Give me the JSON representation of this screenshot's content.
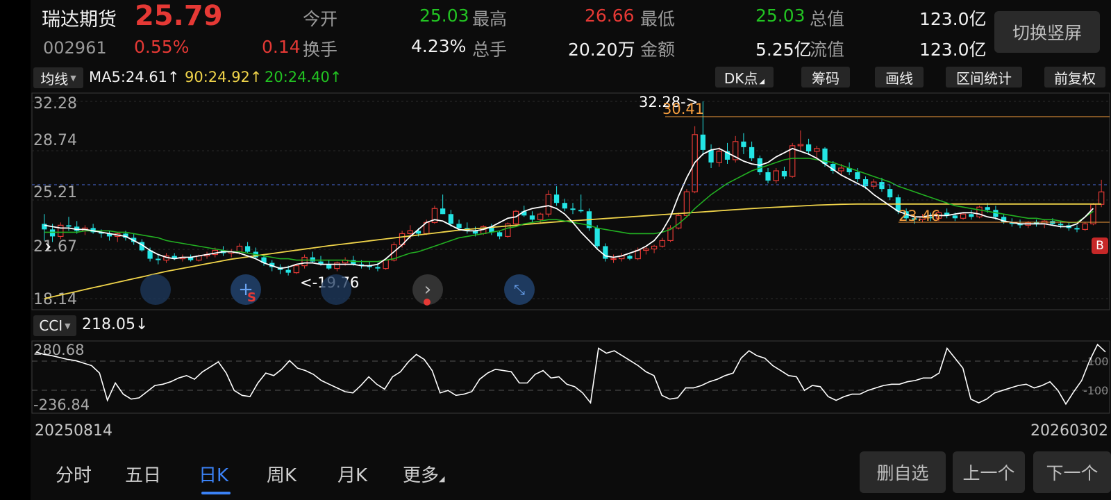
{
  "quote": {
    "name": "瑞达期货",
    "code": "002961",
    "price": "25.79",
    "change_pct": "0.55%",
    "change": "0.14",
    "open_label": "今开",
    "open": "25.03",
    "high_label": "最高",
    "high": "26.66",
    "low_label": "最低",
    "low": "25.03",
    "total_value_label": "总值",
    "total_value": "123.0亿",
    "turnover_label": "换手",
    "turnover": "4.23%",
    "volume_label": "总手",
    "volume": "20.20万",
    "amount_label": "金额",
    "amount": "5.25亿",
    "float_value_label": "流值",
    "float_value": "123.0亿",
    "switch_button": "切换竖屏"
  },
  "ma_bar": {
    "dropdown": "均线",
    "ma5": "MA5:24.61↑",
    "ma90": "90:24.92↑",
    "ma20": "20:24.40↑",
    "buttons": [
      "DK点",
      "筹码",
      "画线",
      "区间统计",
      "前复权"
    ]
  },
  "main_chart": {
    "y_ticks": [
      "32.28",
      "28.74",
      "25.21",
      "21.67",
      "18.14"
    ],
    "y_range": [
      18.14,
      32.28
    ],
    "annotations": {
      "max_marker": "32.28->",
      "min_marker": "<-19.76",
      "upper_line": "30.41",
      "lower_line": "23.46",
      "buy_badge": "B",
      "sell_badge": "S"
    },
    "colors": {
      "up": "#e53935",
      "down": "#23e5e5",
      "ma5": "#ffffff",
      "ma20": "#22b022",
      "ma90": "#f0d44a",
      "price_line": "#4a6ddc"
    }
  },
  "indicator": {
    "dropdown": "CCI",
    "value": "218.05↓",
    "y_ticks": [
      "280.68",
      "-236.84"
    ],
    "ref_lines": [
      "100",
      "-100"
    ]
  },
  "date_range": {
    "start": "20250814",
    "end": "20260302"
  },
  "bottom_tabs": [
    "分时",
    "五日",
    "日K",
    "周K",
    "月K",
    "更多"
  ],
  "active_tab": "日K",
  "bottom_buttons": [
    "删自选",
    "上一个",
    "下一个"
  ],
  "chart_data": {
    "type": "candlestick",
    "ohlc": [
      [
        23.5,
        24.2,
        22.3,
        23.1
      ],
      [
        23.1,
        23.5,
        22.2,
        22.6
      ],
      [
        22.6,
        23.6,
        22.4,
        23.4
      ],
      [
        23.4,
        24.0,
        23.0,
        23.3
      ],
      [
        23.3,
        23.7,
        22.8,
        23.0
      ],
      [
        23.0,
        23.4,
        22.7,
        23.2
      ],
      [
        23.2,
        23.5,
        22.8,
        22.9
      ],
      [
        22.9,
        23.1,
        22.5,
        22.8
      ],
      [
        22.8,
        23.0,
        22.3,
        22.6
      ],
      [
        22.6,
        22.9,
        22.2,
        22.8
      ],
      [
        22.8,
        23.0,
        22.3,
        22.5
      ],
      [
        22.5,
        22.8,
        22.0,
        22.2
      ],
      [
        22.2,
        22.4,
        21.5,
        21.6
      ],
      [
        21.6,
        21.8,
        20.8,
        21.0
      ],
      [
        21.0,
        21.3,
        20.6,
        20.9
      ],
      [
        20.9,
        21.4,
        20.7,
        21.2
      ],
      [
        21.2,
        21.4,
        20.9,
        21.0
      ],
      [
        21.0,
        21.3,
        20.8,
        21.1
      ],
      [
        21.1,
        21.3,
        20.8,
        20.9
      ],
      [
        20.9,
        21.3,
        20.8,
        21.2
      ],
      [
        21.2,
        21.5,
        21.0,
        21.3
      ],
      [
        21.3,
        21.8,
        21.1,
        21.6
      ],
      [
        21.6,
        21.9,
        21.2,
        21.4
      ],
      [
        21.4,
        21.7,
        21.1,
        21.5
      ],
      [
        21.5,
        22.1,
        21.3,
        21.9
      ],
      [
        21.9,
        22.2,
        21.4,
        21.5
      ],
      [
        21.5,
        21.8,
        21.0,
        21.1
      ],
      [
        21.1,
        21.3,
        20.5,
        20.7
      ],
      [
        20.7,
        20.9,
        20.1,
        20.4
      ],
      [
        20.4,
        20.6,
        19.9,
        20.2
      ],
      [
        20.2,
        20.5,
        19.8,
        20.0
      ],
      [
        20.0,
        20.6,
        19.9,
        20.5
      ],
      [
        20.5,
        21.3,
        20.3,
        21.1
      ],
      [
        21.1,
        21.5,
        20.7,
        20.8
      ],
      [
        20.8,
        21.2,
        20.5,
        20.6
      ],
      [
        20.6,
        20.9,
        20.2,
        20.3
      ],
      [
        20.3,
        20.8,
        20.1,
        20.7
      ],
      [
        20.7,
        21.1,
        20.5,
        20.9
      ],
      [
        20.9,
        21.2,
        20.5,
        20.6
      ],
      [
        20.6,
        20.9,
        20.3,
        20.5
      ],
      [
        20.5,
        20.8,
        20.2,
        20.4
      ],
      [
        20.4,
        20.7,
        20.1,
        20.3
      ],
      [
        20.3,
        21.0,
        20.2,
        20.9
      ],
      [
        20.9,
        22.2,
        20.8,
        22.0
      ],
      [
        22.0,
        23.0,
        21.8,
        22.8
      ],
      [
        22.8,
        23.4,
        22.4,
        23.0
      ],
      [
        23.0,
        23.2,
        22.6,
        22.8
      ],
      [
        22.8,
        23.8,
        22.7,
        23.6
      ],
      [
        23.6,
        24.8,
        23.5,
        24.6
      ],
      [
        24.6,
        25.6,
        24.2,
        24.2
      ],
      [
        24.2,
        24.5,
        23.3,
        23.5
      ],
      [
        23.5,
        23.8,
        23.0,
        23.2
      ],
      [
        23.2,
        23.6,
        22.8,
        23.0
      ],
      [
        23.0,
        23.3,
        22.6,
        22.8
      ],
      [
        22.8,
        23.4,
        22.7,
        23.3
      ],
      [
        23.3,
        23.5,
        22.7,
        22.9
      ],
      [
        22.9,
        23.0,
        22.4,
        22.6
      ],
      [
        22.6,
        23.6,
        22.5,
        23.5
      ],
      [
        23.5,
        24.5,
        23.3,
        24.4
      ],
      [
        24.4,
        24.8,
        24.0,
        24.1
      ],
      [
        24.1,
        24.4,
        23.6,
        23.8
      ],
      [
        23.8,
        24.3,
        23.5,
        24.2
      ],
      [
        24.2,
        25.9,
        24.0,
        25.6
      ],
      [
        25.6,
        26.2,
        24.8,
        25.0
      ],
      [
        25.0,
        25.3,
        24.4,
        24.6
      ],
      [
        24.6,
        25.0,
        24.2,
        24.5
      ],
      [
        24.5,
        25.6,
        24.3,
        24.4
      ],
      [
        24.4,
        24.6,
        23.0,
        23.2
      ],
      [
        23.2,
        23.4,
        21.7,
        21.9
      ],
      [
        21.9,
        22.1,
        20.8,
        21.0
      ],
      [
        21.0,
        21.3,
        20.7,
        21.0
      ],
      [
        21.0,
        21.4,
        20.8,
        21.2
      ],
      [
        21.2,
        21.3,
        20.9,
        21.0
      ],
      [
        21.0,
        21.8,
        20.9,
        21.6
      ],
      [
        21.6,
        21.9,
        21.3,
        21.7
      ],
      [
        21.7,
        22.0,
        21.4,
        21.9
      ],
      [
        21.9,
        22.5,
        21.8,
        22.3
      ],
      [
        22.3,
        23.4,
        22.2,
        23.2
      ],
      [
        23.2,
        24.3,
        23.1,
        24.1
      ],
      [
        24.1,
        26.0,
        24.0,
        25.8
      ],
      [
        25.8,
        30.5,
        25.7,
        29.9
      ],
      [
        29.9,
        32.28,
        28.4,
        28.8
      ],
      [
        28.8,
        29.2,
        27.5,
        27.9
      ],
      [
        27.9,
        29.0,
        27.6,
        28.7
      ],
      [
        28.7,
        29.3,
        27.8,
        28.1
      ],
      [
        28.1,
        29.8,
        27.9,
        29.4
      ],
      [
        29.4,
        30.0,
        28.5,
        29.0
      ],
      [
        29.0,
        29.4,
        28.0,
        28.2
      ],
      [
        28.2,
        28.4,
        27.0,
        27.2
      ],
      [
        27.2,
        27.5,
        26.4,
        26.6
      ],
      [
        26.6,
        27.5,
        26.4,
        27.3
      ],
      [
        27.3,
        27.6,
        26.7,
        26.9
      ],
      [
        26.9,
        29.3,
        26.8,
        29.1
      ],
      [
        29.1,
        30.2,
        28.7,
        29.2
      ],
      [
        29.2,
        29.6,
        28.5,
        28.7
      ],
      [
        28.7,
        29.1,
        28.2,
        28.9
      ],
      [
        28.9,
        29.0,
        27.6,
        27.8
      ],
      [
        27.8,
        28.0,
        27.1,
        27.3
      ],
      [
        27.3,
        27.8,
        27.0,
        27.5
      ],
      [
        27.5,
        27.9,
        27.0,
        27.2
      ],
      [
        27.2,
        27.5,
        26.5,
        26.7
      ],
      [
        26.7,
        26.9,
        26.0,
        26.2
      ],
      [
        26.2,
        26.7,
        26.0,
        26.5
      ],
      [
        26.5,
        26.8,
        25.8,
        26.0
      ],
      [
        26.0,
        26.3,
        25.2,
        25.4
      ],
      [
        25.4,
        25.6,
        24.2,
        24.4
      ],
      [
        24.4,
        24.6,
        23.7,
        23.9
      ],
      [
        23.9,
        24.1,
        23.5,
        23.8
      ],
      [
        23.8,
        24.2,
        23.6,
        24.0
      ],
      [
        24.0,
        24.3,
        23.7,
        23.9
      ],
      [
        23.9,
        24.4,
        23.7,
        24.3
      ],
      [
        24.3,
        24.6,
        23.9,
        24.1
      ],
      [
        24.1,
        24.3,
        23.7,
        23.9
      ],
      [
        23.9,
        24.3,
        23.8,
        24.2
      ],
      [
        24.2,
        24.5,
        23.8,
        24.0
      ],
      [
        24.0,
        24.8,
        23.9,
        24.7
      ],
      [
        24.7,
        25.0,
        24.3,
        24.5
      ],
      [
        24.5,
        24.8,
        23.8,
        24.0
      ],
      [
        24.0,
        24.2,
        23.5,
        23.6
      ],
      [
        23.6,
        23.9,
        23.3,
        23.5
      ],
      [
        23.5,
        23.8,
        23.2,
        23.4
      ],
      [
        23.4,
        23.7,
        23.2,
        23.6
      ],
      [
        23.6,
        23.8,
        23.3,
        23.5
      ],
      [
        23.5,
        23.8,
        23.2,
        23.7
      ],
      [
        23.7,
        23.9,
        23.4,
        23.5
      ],
      [
        23.5,
        23.7,
        23.2,
        23.4
      ],
      [
        23.4,
        23.6,
        23.0,
        23.2
      ],
      [
        23.2,
        23.4,
        22.9,
        23.1
      ],
      [
        23.1,
        23.6,
        23.0,
        23.5
      ],
      [
        23.5,
        25.0,
        23.4,
        24.9
      ],
      [
        24.9,
        26.66,
        24.7,
        25.79
      ]
    ],
    "ma5": [
      23.4,
      23.3,
      23.2,
      23.2,
      23.1,
      23.1,
      23.0,
      22.9,
      22.8,
      22.7,
      22.6,
      22.3,
      22.0,
      21.6,
      21.3,
      21.1,
      21.0,
      21.1,
      21.1,
      21.2,
      21.3,
      21.4,
      21.5,
      21.5,
      21.4,
      21.2,
      21.0,
      20.7,
      20.5,
      20.3,
      20.4,
      20.6,
      20.7,
      20.7,
      20.6,
      20.6,
      20.6,
      20.6,
      20.6,
      20.5,
      20.5,
      20.6,
      21.0,
      21.5,
      22.0,
      22.6,
      23.1,
      23.6,
      23.8,
      23.7,
      23.4,
      23.1,
      23.0,
      23.0,
      23.1,
      23.3,
      23.6,
      23.9,
      24.0,
      24.4,
      24.6,
      24.7,
      24.8,
      24.6,
      24.2,
      23.6,
      22.9,
      22.3,
      21.7,
      21.2,
      21.1,
      21.2,
      21.4,
      21.6,
      21.9,
      22.3,
      23.0,
      24.0,
      25.5,
      26.8,
      27.9,
      28.5,
      28.8,
      28.9,
      28.6,
      28.3,
      28.0,
      27.8,
      27.7,
      27.9,
      28.3,
      28.6,
      28.9,
      28.7,
      28.5,
      28.2,
      27.8,
      27.4,
      27.0,
      26.7,
      26.4,
      26.1,
      25.6,
      25.2,
      24.8,
      24.4,
      24.2,
      24.0,
      24.0,
      24.1,
      24.1,
      24.1,
      24.2,
      24.3,
      24.3,
      24.2,
      24.0,
      23.9,
      23.7,
      23.6,
      23.5,
      23.5,
      23.5,
      23.5,
      23.4,
      23.3,
      23.3,
      23.5,
      24.0,
      24.61
    ],
    "ma20": [
      22.9,
      22.9,
      22.9,
      22.9,
      22.9,
      23.0,
      23.0,
      23.0,
      23.0,
      22.9,
      22.9,
      22.8,
      22.7,
      22.6,
      22.5,
      22.3,
      22.2,
      22.1,
      22.0,
      21.9,
      21.8,
      21.7,
      21.6,
      21.5,
      21.5,
      21.4,
      21.3,
      21.2,
      21.1,
      21.0,
      21.0,
      20.9,
      20.9,
      20.9,
      20.9,
      20.9,
      20.9,
      20.9,
      20.8,
      20.8,
      20.8,
      20.8,
      20.9,
      21.0,
      21.2,
      21.4,
      21.5,
      21.7,
      21.9,
      22.1,
      22.3,
      22.5,
      22.6,
      22.7,
      22.8,
      22.9,
      23.0,
      23.2,
      23.3,
      23.5,
      23.6,
      23.7,
      23.8,
      23.8,
      23.7,
      23.6,
      23.5,
      23.4,
      23.2,
      23.1,
      23.0,
      22.9,
      22.8,
      22.8,
      22.8,
      22.8,
      22.9,
      23.1,
      23.5,
      24.0,
      24.6,
      25.1,
      25.6,
      26.0,
      26.4,
      26.7,
      27.0,
      27.3,
      27.5,
      27.7,
      27.9,
      28.1,
      28.2,
      28.2,
      28.2,
      28.1,
      28.0,
      27.9,
      27.7,
      27.5,
      27.3,
      27.1,
      26.9,
      26.7,
      26.5,
      26.2,
      26.0,
      25.8,
      25.6,
      25.4,
      25.2,
      25.0,
      24.8,
      24.7,
      24.6,
      24.5,
      24.4,
      24.3,
      24.2,
      24.1,
      24.0,
      23.9,
      23.9,
      23.8,
      23.8,
      23.7,
      23.6,
      23.6,
      24.0,
      24.4
    ],
    "ma90": [
      18.14,
      18.27,
      18.4,
      18.53,
      18.66,
      18.79,
      18.92,
      19.05,
      19.18,
      19.31,
      19.44,
      19.57,
      19.7,
      19.83,
      19.96,
      20.09,
      20.2,
      20.31,
      20.42,
      20.53,
      20.64,
      20.75,
      20.86,
      20.97,
      21.05,
      21.13,
      21.21,
      21.29,
      21.37,
      21.45,
      21.53,
      21.61,
      21.69,
      21.77,
      21.85,
      21.93,
      22.0,
      22.07,
      22.14,
      22.21,
      22.28,
      22.35,
      22.42,
      22.49,
      22.56,
      22.63,
      22.7,
      22.77,
      22.84,
      22.91,
      22.98,
      23.05,
      23.1,
      23.15,
      23.2,
      23.25,
      23.3,
      23.35,
      23.4,
      23.45,
      23.5,
      23.55,
      23.6,
      23.64,
      23.68,
      23.72,
      23.76,
      23.8,
      23.84,
      23.88,
      23.92,
      23.96,
      24.0,
      24.04,
      24.08,
      24.12,
      24.16,
      24.2,
      24.24,
      24.28,
      24.32,
      24.36,
      24.4,
      24.44,
      24.48,
      24.52,
      24.56,
      24.6,
      24.63,
      24.66,
      24.69,
      24.72,
      24.75,
      24.78,
      24.81,
      24.84,
      24.86,
      24.88,
      24.9,
      24.91,
      24.92,
      24.92,
      24.92,
      24.92,
      24.92,
      24.92,
      24.92,
      24.92,
      24.92,
      24.92,
      24.92,
      24.92,
      24.92,
      24.92,
      24.92,
      24.92,
      24.92,
      24.92,
      24.92,
      24.92,
      24.92,
      24.92,
      24.92,
      24.92,
      24.92,
      24.92,
      24.92,
      24.92,
      24.92,
      24.92,
      24.92
    ],
    "cci": [
      230,
      210,
      200,
      185,
      170,
      160,
      140,
      120,
      60,
      -160,
      -20,
      -110,
      -150,
      -140,
      -90,
      -40,
      -30,
      -10,
      20,
      40,
      10,
      70,
      110,
      150,
      60,
      -80,
      -120,
      -130,
      -20,
      60,
      40,
      90,
      160,
      100,
      80,
      50,
      0,
      -30,
      -60,
      -90,
      -100,
      -40,
      30,
      -30,
      -70,
      30,
      70,
      150,
      210,
      170,
      80,
      -100,
      -80,
      -120,
      -110,
      -90,
      10,
      60,
      90,
      80,
      70,
      -20,
      -20,
      50,
      80,
      20,
      30,
      -30,
      -50,
      -100,
      -180,
      260,
      220,
      240,
      200,
      160,
      120,
      70,
      40,
      -120,
      -150,
      -140,
      -60,
      -60,
      -40,
      -10,
      10,
      40,
      60,
      180,
      240,
      200,
      180,
      120,
      80,
      40,
      30,
      -80,
      -40,
      -50,
      -130,
      -160,
      -130,
      -110,
      -110,
      -80,
      -60,
      -40,
      -30,
      -30,
      -10,
      0,
      20,
      20,
      60,
      260,
      180,
      100,
      -150,
      -180,
      -150,
      -100,
      -80,
      -60,
      -40,
      -30,
      -60,
      -40,
      -10,
      -80,
      -190,
      -90,
      0,
      160,
      290,
      230
    ]
  }
}
